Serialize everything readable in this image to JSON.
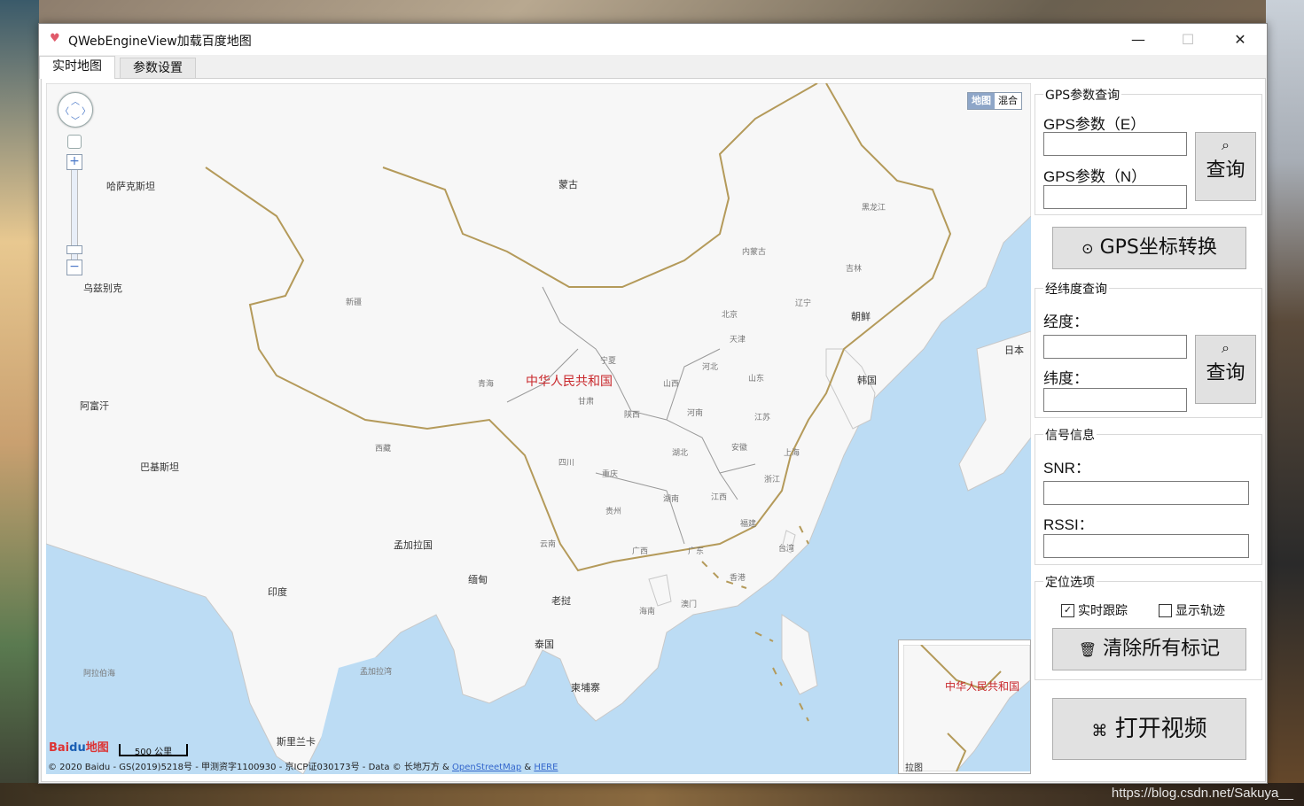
{
  "window": {
    "title": "QWebEngineView加载百度地图",
    "minimize": "—",
    "maximize": "☐",
    "close": "✕"
  },
  "tabs": [
    {
      "label": "实时地图"
    },
    {
      "label": "参数设置"
    }
  ],
  "map": {
    "type_map": "地图",
    "type_hybrid": "混合",
    "labels": {
      "mongolia": "蒙古",
      "kazakhstan": "哈萨克斯坦",
      "uzbekistan": "乌兹别克",
      "afghanistan": "阿富汗",
      "pakistan": "巴基斯坦",
      "india": "印度",
      "bangladesh": "孟加拉国",
      "myanmar": "缅甸",
      "laos": "老挝",
      "thailand": "泰国",
      "cambodia": "柬埔寨",
      "srilanka": "斯里兰卡",
      "arabian_sea": "阿拉伯海",
      "bay_of_bengal": "孟加拉湾",
      "nkorea": "朝鲜",
      "skorea": "韩国",
      "japan": "日本",
      "china": "中华人民共和国",
      "heilongjiang": "黑龙江",
      "jilin": "吉林",
      "liaoning": "辽宁",
      "neimenggu": "内蒙古",
      "beijing": "北京",
      "tianjin": "天津",
      "hebei": "河北",
      "shanxi": "山西",
      "shandong": "山东",
      "xinjiang": "新疆",
      "qinghai": "青海",
      "gansu": "甘肃",
      "ningxia": "宁夏",
      "shaanxi": "陕西",
      "henan": "河南",
      "jiangsu": "江苏",
      "anhui": "安徽",
      "shanghai": "上海",
      "hubei": "湖北",
      "xizang": "西藏",
      "sichuan": "四川",
      "chongqing": "重庆",
      "zhejiang": "浙江",
      "guizhou": "贵州",
      "hunan": "湖南",
      "jiangxi": "江西",
      "fujian": "福建",
      "taiwan": "台湾",
      "yunnan": "云南",
      "guangxi": "广西",
      "guangdong": "广东",
      "hongkong": "香港",
      "macau": "澳门",
      "hainan": "海南"
    },
    "logo_baidu": "Bai",
    "logo_du": "du",
    "logo_map": "地图",
    "scale": "500 公里",
    "copyright_prefix": "© 2020 Baidu - GS(2019)5218号 - 甲测资字1100930 - 京ICP证030173号 - Data © 长地万方 & ",
    "osm_link": "OpenStreetMap",
    "amp": " & ",
    "here_link": "HERE",
    "overview_label": "中华人民共和国",
    "overview_pull": "拉图"
  },
  "gps_query": {
    "title": "GPS参数查询",
    "label_e": "GPS参数（E）",
    "value_e": "",
    "label_n": "GPS参数（N）",
    "value_n": "",
    "query_label": "查询"
  },
  "convert_button": "GPS坐标转换",
  "latlng_query": {
    "title": "经纬度查询",
    "label_lng": "经度：",
    "value_lng": "",
    "label_lat": "纬度：",
    "value_lat": "",
    "query_label": "查询"
  },
  "signal": {
    "title": "信号信息",
    "label_snr": "SNR：",
    "value_snr": "",
    "label_rssi": "RSSI：",
    "value_rssi": ""
  },
  "positioning": {
    "title": "定位选项",
    "realtime_track": "实时跟踪",
    "realtime_track_checked": true,
    "show_trace": "显示轨迹",
    "show_trace_checked": false,
    "clear_button": "清除所有标记"
  },
  "open_video_button": "打开视频",
  "watermark": "https://blog.csdn.net/Sakuya__",
  "icons": {
    "search": "search-icon",
    "pin": "location-pin-icon",
    "trash": "trash-icon",
    "camera": "camera-icon"
  }
}
